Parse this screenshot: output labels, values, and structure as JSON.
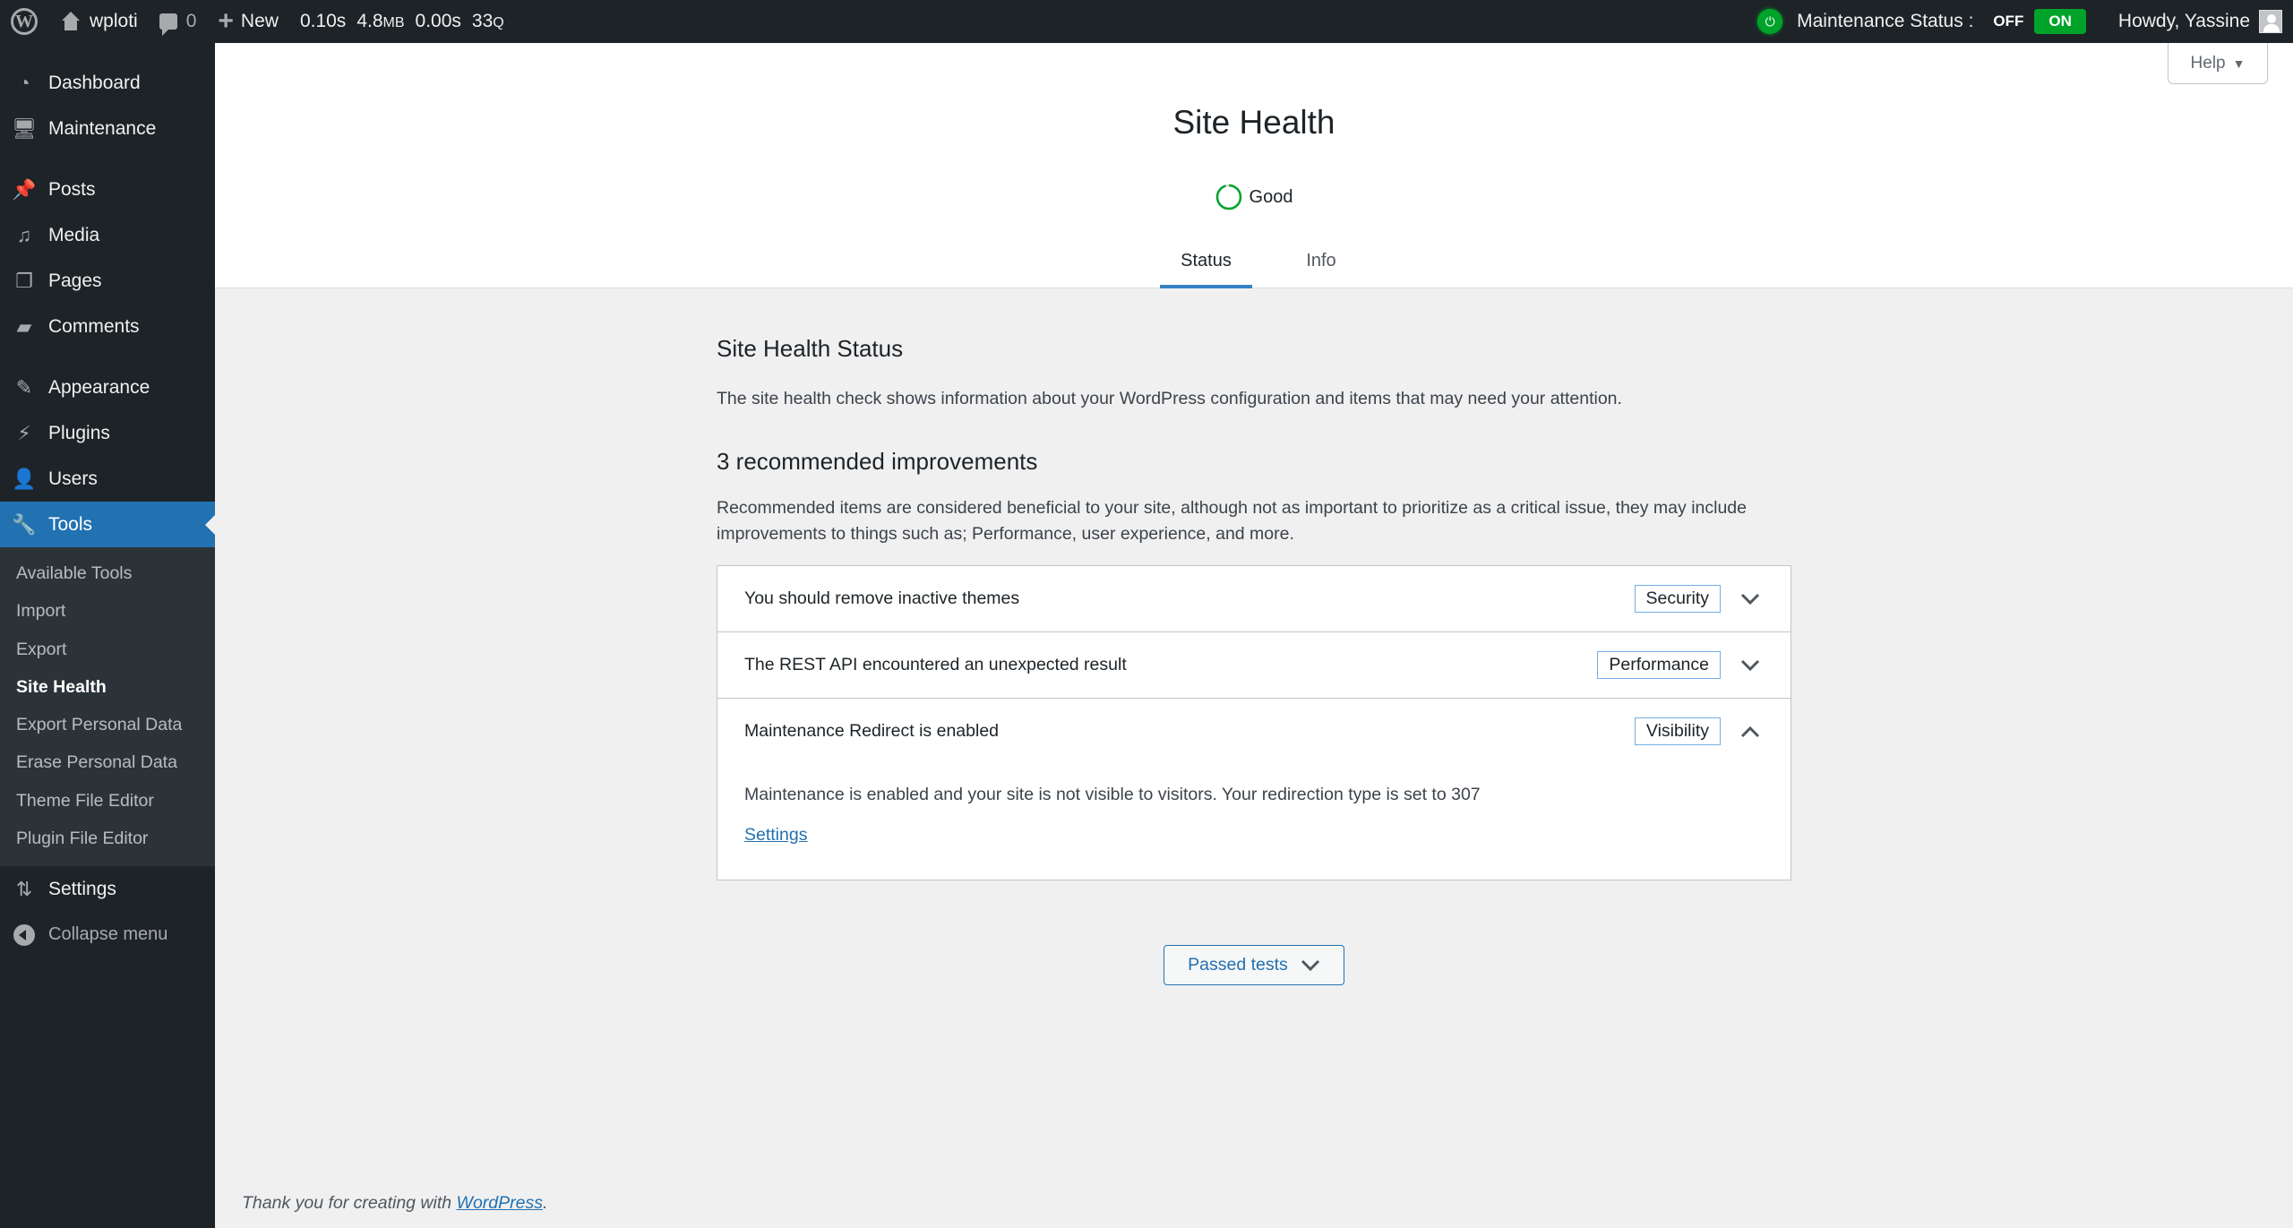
{
  "adminbar": {
    "site_name": "wploti",
    "comments_count": "0",
    "new_label": "New",
    "query_monitor": {
      "time": "0.10s",
      "memory": "4.8",
      "memory_unit": "MB",
      "db_time": "0.00s",
      "queries": "33",
      "queries_unit": "Q"
    },
    "maintenance_label": "Maintenance Status :",
    "maintenance_off": "OFF",
    "maintenance_on": "ON",
    "maintenance_state": "ON",
    "howdy": "Howdy, Yassine",
    "colors": {
      "bar_bg": "#1d2327",
      "on_green": "#00a32a"
    }
  },
  "sidebar": {
    "items": [
      {
        "label": "Dashboard",
        "icon": "dashboard-icon"
      },
      {
        "label": "Maintenance",
        "icon": "monitor-icon"
      },
      {
        "label": "Posts",
        "icon": "pushpin-icon"
      },
      {
        "label": "Media",
        "icon": "media-icon"
      },
      {
        "label": "Pages",
        "icon": "pages-icon"
      },
      {
        "label": "Comments",
        "icon": "comment-icon"
      },
      {
        "label": "Appearance",
        "icon": "brush-icon"
      },
      {
        "label": "Plugins",
        "icon": "plugin-icon"
      },
      {
        "label": "Users",
        "icon": "user-icon"
      },
      {
        "label": "Tools",
        "icon": "wrench-icon",
        "active": true
      },
      {
        "label": "Settings",
        "icon": "settings-icon"
      }
    ],
    "tools_submenu": [
      {
        "label": "Available Tools"
      },
      {
        "label": "Import"
      },
      {
        "label": "Export"
      },
      {
        "label": "Site Health",
        "current": true
      },
      {
        "label": "Export Personal Data"
      },
      {
        "label": "Erase Personal Data"
      },
      {
        "label": "Theme File Editor"
      },
      {
        "label": "Plugin File Editor"
      }
    ],
    "collapse_label": "Collapse menu",
    "colors": {
      "active_bg": "#2271b1"
    }
  },
  "header": {
    "help_label": "Help",
    "title": "Site Health",
    "rating_label": "Good",
    "rating_progress_percent": 95,
    "tabs": [
      {
        "label": "Status",
        "active": true
      },
      {
        "label": "Info",
        "active": false
      }
    ]
  },
  "main": {
    "status_title": "Site Health Status",
    "status_desc": "The site health check shows information about your WordPress configuration and items that may need your attention.",
    "improvements_title": "3 recommended improvements",
    "improvements_desc": "Recommended items are considered beneficial to your site, although not as important to prioritize as a critical issue, they may include improvements to things such as; Performance, user experience, and more.",
    "issues": [
      {
        "title": "You should remove inactive themes",
        "badge": "Security",
        "expanded": false
      },
      {
        "title": "The REST API encountered an unexpected result",
        "badge": "Performance",
        "expanded": false
      },
      {
        "title": "Maintenance Redirect is enabled",
        "badge": "Visibility",
        "expanded": true,
        "body": "Maintenance is enabled and your site is not visible to visitors. Your redirection type is set to 307",
        "link_label": "Settings"
      }
    ],
    "passed_tests_label": "Passed tests"
  },
  "footer": {
    "text": "Thank you for creating with ",
    "link_label": "WordPress",
    "suffix": "."
  }
}
